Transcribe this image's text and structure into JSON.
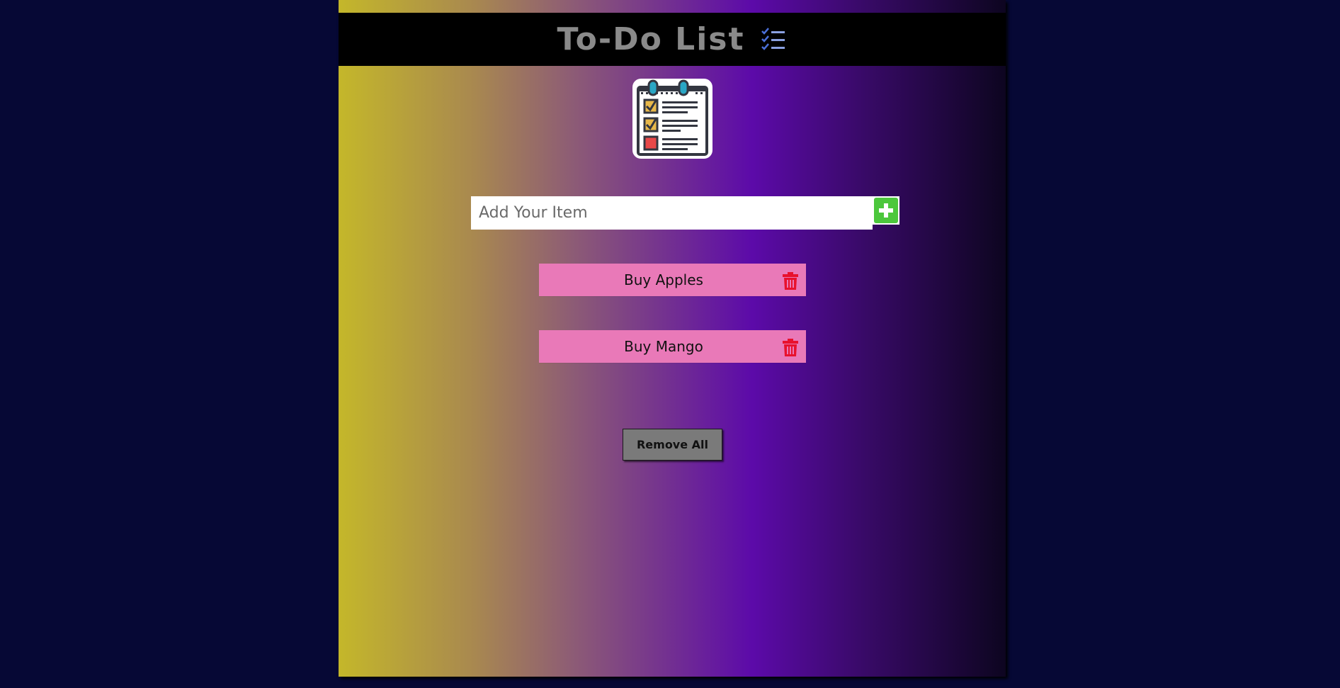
{
  "header": {
    "title": "To-Do List",
    "title_icon": "checklist-icon"
  },
  "logo": {
    "icon": "notepad-checklist-icon"
  },
  "input": {
    "placeholder": "Add Your Item",
    "value": "",
    "add_icon": "plus-icon"
  },
  "todos": [
    {
      "label": "Buy Apples",
      "delete_icon": "trash-icon"
    },
    {
      "label": "Buy Mango",
      "delete_icon": "trash-icon"
    }
  ],
  "actions": {
    "remove_all_label": "Remove All"
  },
  "colors": {
    "page_background": "#060835",
    "header_background": "#000000",
    "todo_item_background": "#e979b8",
    "add_button": "#4cc73c",
    "delete_icon": "#e8112d",
    "remove_all_button": "#7a7a7a"
  }
}
